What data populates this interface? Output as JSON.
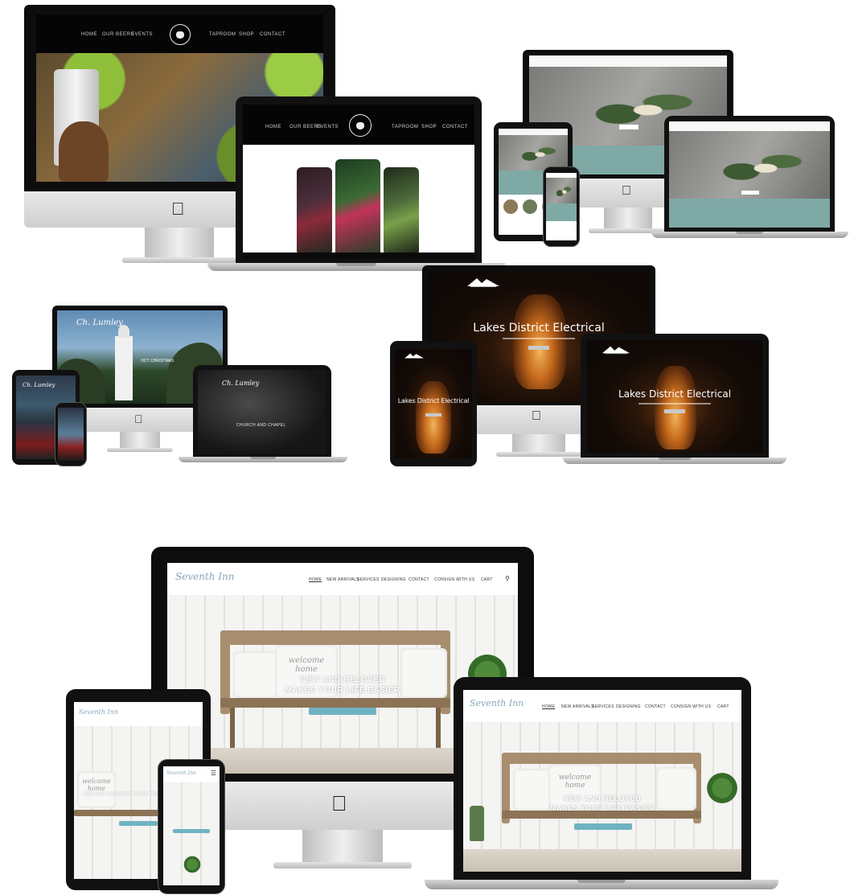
{
  "brewery": {
    "nav_left": [
      "HOME",
      "OUR BEERS",
      "EVENTS"
    ],
    "nav_right": [
      "TAPROOM",
      "SHOP",
      "CONTACT"
    ]
  },
  "church": {
    "hero_title": "Ch. Lumley",
    "sub_title": "OCT CHRISTMAS",
    "dark_line": "CHURCH AND CHAPEL"
  },
  "electrical": {
    "title": "Lakes District Electrical",
    "tablet_title": "Lakes District Electrical",
    "laptop_title": "Lakes District Electrical"
  },
  "store": {
    "logo": "Seventh Inn",
    "nav": [
      "HOME",
      "NEW ARRIVALS",
      "SERVICES",
      "DESIGNING",
      "CONTACT",
      "CONSIGN WITH US",
      "CART"
    ],
    "headline_line1": "NEW AND RELOVED",
    "headline_line2": "MAKES YOUR LIFE EASIER",
    "pillow_text": "welcome home",
    "tablet_headline": "NEW AND RELOVED MAKES YOUR LIFE EASIER"
  },
  "colors": {
    "store_accent": "#6fb3c2",
    "florist_band": "#7fa9a5",
    "brewery_dark": "#050505"
  }
}
